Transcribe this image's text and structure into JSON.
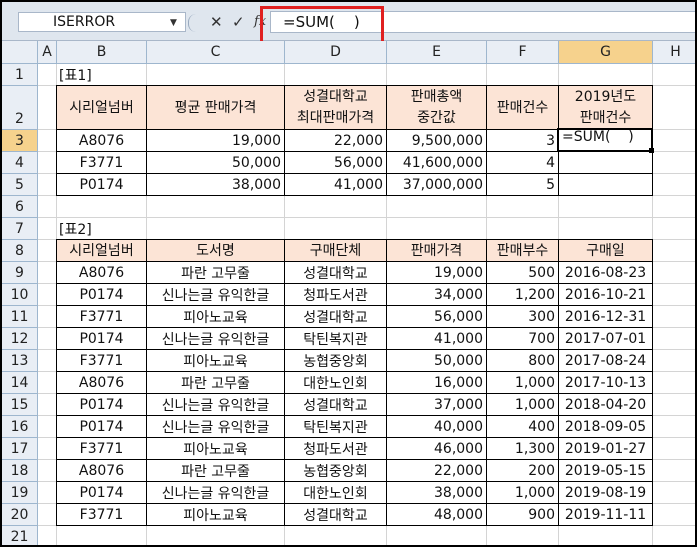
{
  "formula_bar": {
    "name_box": "ISERROR",
    "cancel_icon": "✕",
    "enter_icon": "✓",
    "fx_label": "fx",
    "formula": "=SUM(    )"
  },
  "columns": [
    "A",
    "B",
    "C",
    "D",
    "E",
    "F",
    "G",
    "H"
  ],
  "rows": [
    "1",
    "2",
    "3",
    "4",
    "5",
    "6",
    "7",
    "8",
    "9",
    "10",
    "11",
    "12",
    "13",
    "14",
    "15",
    "16",
    "17",
    "18",
    "19",
    "20",
    "21"
  ],
  "table1": {
    "title": "[표1]",
    "headers": {
      "serial": "시리얼넘버",
      "avg_price": "평균 판매가격",
      "max_price_line1": "성결대학교",
      "max_price_line2": "최대판매가격",
      "median_line1": "판매총액",
      "median_line2": "중간값",
      "count": "판매건수",
      "y2019_line1": "2019년도",
      "y2019_line2": "판매건수"
    },
    "rows": [
      {
        "serial": "A8076",
        "avg": "19,000",
        "max": "22,000",
        "median": "9,500,000",
        "count": "3",
        "y2019": "=SUM(    )"
      },
      {
        "serial": "F3771",
        "avg": "50,000",
        "max": "56,000",
        "median": "41,600,000",
        "count": "4",
        "y2019": ""
      },
      {
        "serial": "P0174",
        "avg": "38,000",
        "max": "41,000",
        "median": "37,000,000",
        "count": "5",
        "y2019": ""
      }
    ]
  },
  "table2": {
    "title": "[표2]",
    "headers": [
      "시리얼넘버",
      "도서명",
      "구매단체",
      "판매가격",
      "판매부수",
      "구매일"
    ],
    "rows": [
      [
        "A8076",
        "파란 고무줄",
        "성결대학교",
        "19,000",
        "500",
        "2016-08-23"
      ],
      [
        "P0174",
        "신나는글 유익한글",
        "청파도서관",
        "34,000",
        "1,200",
        "2016-10-21"
      ],
      [
        "F3771",
        "피아노교육",
        "성결대학교",
        "56,000",
        "300",
        "2016-12-31"
      ],
      [
        "P0174",
        "신나는글 유익한글",
        "탁틴복지관",
        "41,000",
        "700",
        "2017-07-01"
      ],
      [
        "F3771",
        "피아노교육",
        "농협중앙회",
        "50,000",
        "800",
        "2017-08-24"
      ],
      [
        "A8076",
        "파란 고무줄",
        "대한노인회",
        "16,000",
        "1,000",
        "2017-10-13"
      ],
      [
        "P0174",
        "신나는글 유익한글",
        "성결대학교",
        "37,000",
        "1,000",
        "2018-04-20"
      ],
      [
        "P0174",
        "신나는글 유익한글",
        "탁틴복지관",
        "40,000",
        "400",
        "2018-09-05"
      ],
      [
        "F3771",
        "피아노교육",
        "청파도서관",
        "46,000",
        "1,300",
        "2019-01-27"
      ],
      [
        "A8076",
        "파란 고무줄",
        "농협중앙회",
        "22,000",
        "200",
        "2019-05-15"
      ],
      [
        "P0174",
        "신나는글 유익한글",
        "대한노인회",
        "38,000",
        "1,000",
        "2019-08-19"
      ],
      [
        "F3771",
        "피아노교육",
        "성결대학교",
        "48,000",
        "900",
        "2019-11-11"
      ]
    ]
  },
  "colors": {
    "header_fill": "#fce4d6",
    "selected_header": "#f6d28d",
    "highlight_box": "#e02020"
  }
}
